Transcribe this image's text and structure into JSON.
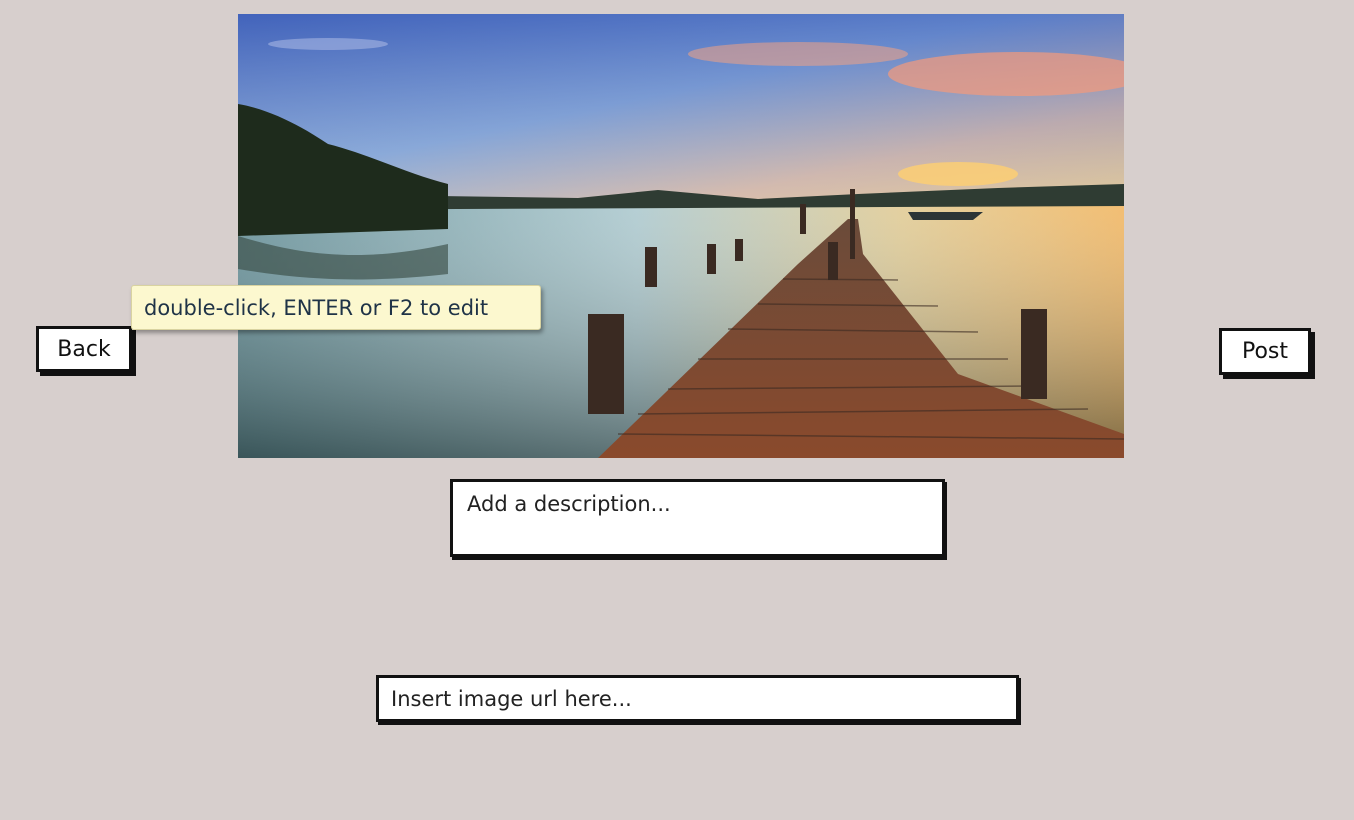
{
  "buttons": {
    "back_label": "Back",
    "post_label": "Post"
  },
  "tooltip": {
    "text": "double-click, ENTER or F2 to edit"
  },
  "description": {
    "placeholder": "Add a description..."
  },
  "image_url": {
    "placeholder": "Insert image url here..."
  },
  "colors": {
    "background": "#d7cfcd",
    "tooltip_bg": "#fcf8cf",
    "border": "#111111"
  }
}
